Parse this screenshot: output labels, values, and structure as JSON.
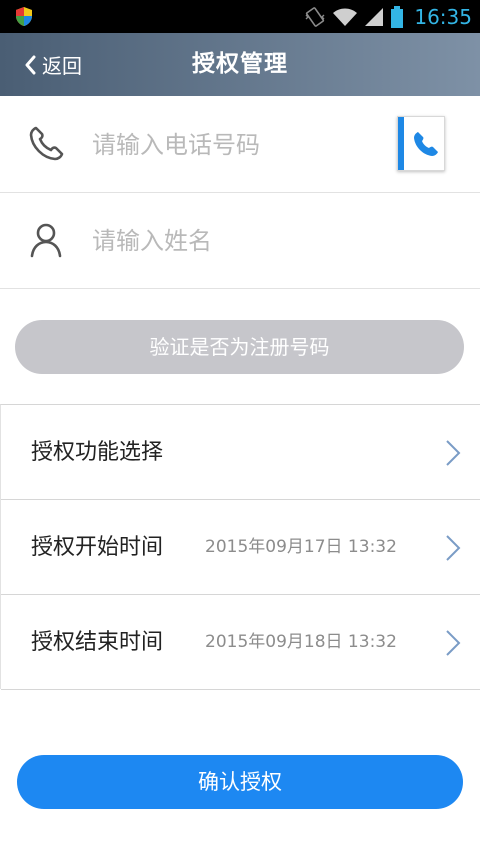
{
  "status_bar": {
    "time": "16:35",
    "icons": [
      "shield-icon",
      "vibrate-icon",
      "wifi-icon",
      "signal-icon",
      "battery-icon"
    ]
  },
  "title_bar": {
    "back_label": "返回",
    "title": "授权管理"
  },
  "form": {
    "phone_placeholder": "请输入电话号码",
    "phone_value": "",
    "name_placeholder": "请输入姓名",
    "name_value": "",
    "verify_label": "验证是否为注册号码"
  },
  "settings": [
    {
      "label": "授权功能选择",
      "value": ""
    },
    {
      "label": "授权开始时间",
      "value": "2015年09月17日 13:32"
    },
    {
      "label": "授权结束时间",
      "value": "2015年09月18日 13:32"
    }
  ],
  "confirm_label": "确认授权",
  "colors": {
    "accent": "#1d88f2",
    "disabled_button": "#c6c6cb",
    "status_text": "#33b5e5"
  }
}
